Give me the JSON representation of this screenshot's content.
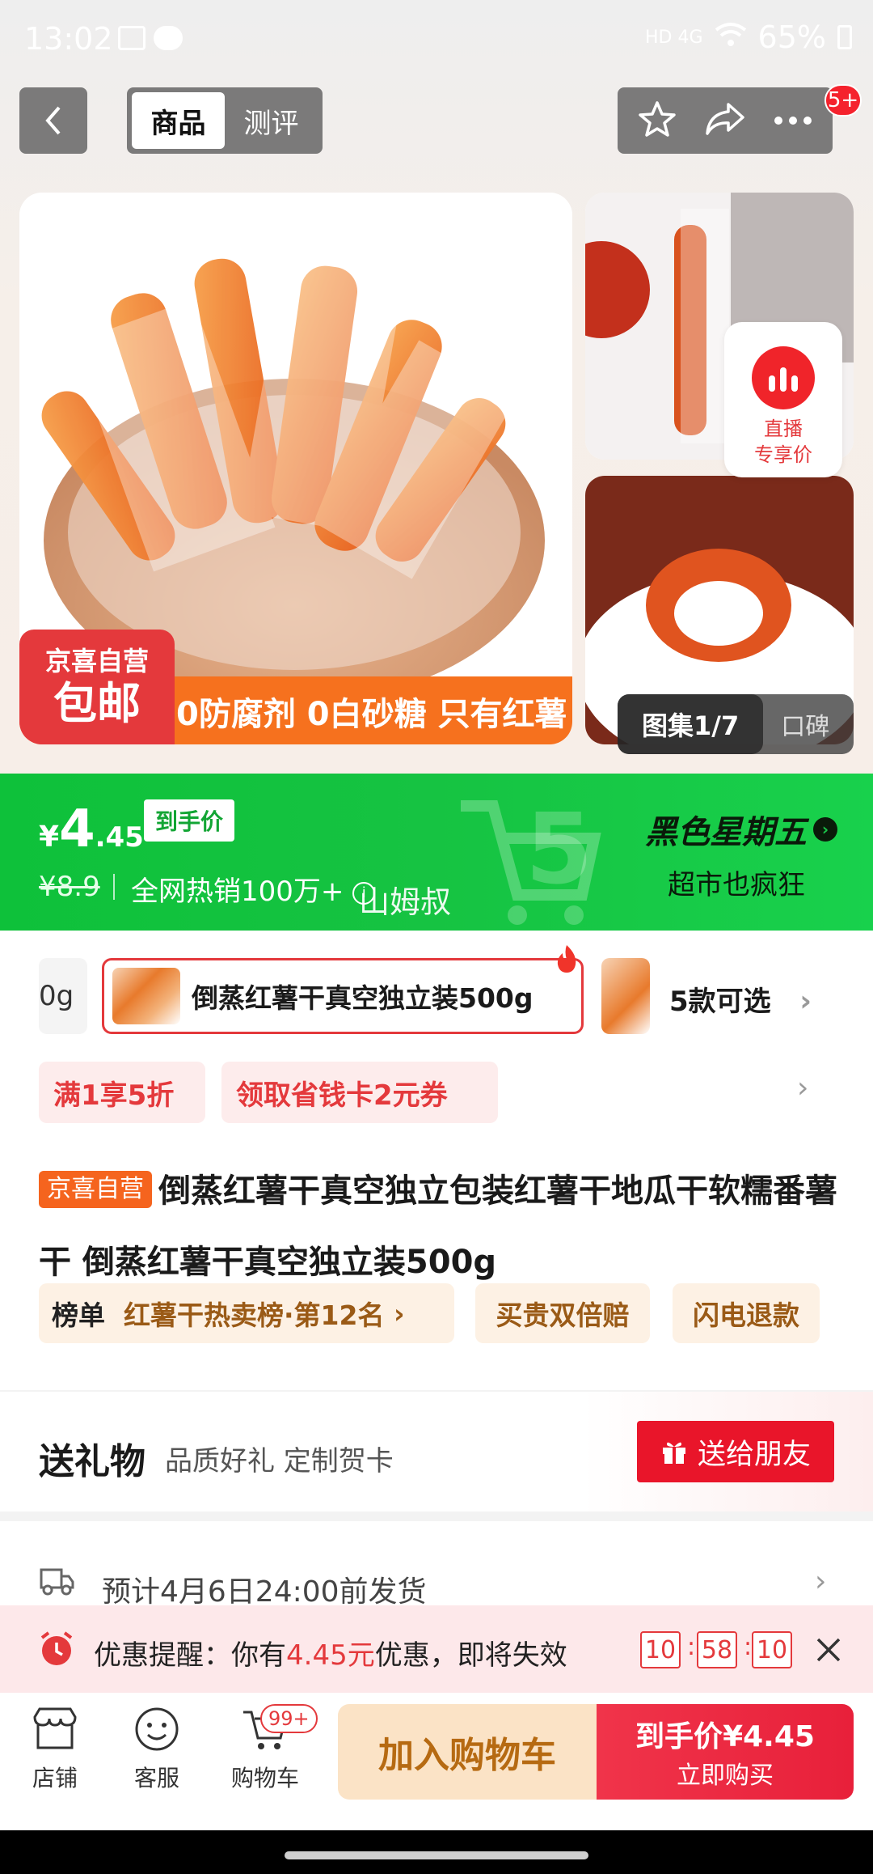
{
  "status_bar": {
    "time": "13:02",
    "battery": "65%",
    "network": "HD 4G"
  },
  "nav": {
    "tabs": [
      "商品",
      "测评"
    ],
    "badge": "5+"
  },
  "live": {
    "label_line1": "直播",
    "label_line2": "专享价"
  },
  "banner": {
    "brand_line1": "京喜自营",
    "brand_line2": "包邮",
    "slogan": "0防腐剂 0白砂糖 只有红薯"
  },
  "gallery": {
    "counter": "图集1/7",
    "reviews": "口碑"
  },
  "price": {
    "currency": "¥",
    "int": "4",
    "dec": ".45",
    "tag": "到手价",
    "original": "¥8.9",
    "sales": "全网热销100万+",
    "watermark": "山姆叔",
    "event_title": "黑色星期五",
    "event_sub": "超市也疯狂"
  },
  "sku": {
    "prev_text": "0g",
    "selected": "倒蒸红薯干真空独立装500g",
    "more": "5款可选"
  },
  "promos": [
    "满1享5折",
    "领取省钱卡2元券"
  ],
  "product": {
    "badge": "京喜自营",
    "title": "倒蒸红薯干真空独立包装红薯干地瓜干软糯番薯干 倒蒸红薯干真空独立装500g"
  },
  "chips": {
    "rank_label": "榜单",
    "rank_text": "红薯干热卖榜·第12名",
    "chip2": "买贵双倍赔",
    "chip3": "闪电退款"
  },
  "gift": {
    "title": "送礼物",
    "subtitle": "品质好礼 定制贺卡",
    "button": "送给朋友"
  },
  "shipping": {
    "text": "预计4月6日24:00前发货"
  },
  "reminder": {
    "prefix": "优惠提醒：你有",
    "amount": "4.45元",
    "suffix": "优惠，即将失效",
    "h": "10",
    "m": "58",
    "s": "10"
  },
  "bottom": {
    "shop": "店铺",
    "service": "客服",
    "cart": "购物车",
    "cart_badge": "99+",
    "add_cart": "加入购物车",
    "buy_line1_prefix": "到手价",
    "buy_price": "¥4.45",
    "buy_line2": "立即购买"
  },
  "colors": {
    "accent": "#e4393c",
    "green": "#16c342"
  }
}
